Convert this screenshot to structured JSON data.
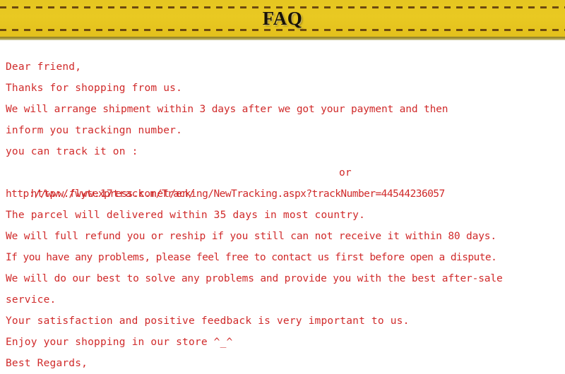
{
  "banner": {
    "title": "FAQ",
    "background_color": "#E6C620",
    "dash_color": "#6D4A10",
    "shadow_color": "#8E7D23"
  },
  "body": {
    "text_color": "#D02A2A",
    "background_color": "#FFFFFF",
    "lines": [
      "Dear friend,",
      "Thanks for shopping from us.",
      "We will arrange shipment within 3 days after we got your payment and then",
      "inform you trackingn number.",
      "you can track it on :",
      "http://www.17track.net/en/",
      "http://www.flytexpress.com/Tracking/NewTracking.aspx?trackNumber=44544236057",
      "The parcel will delivered within 35 days in most country.",
      "We will full refund you or reship if you still can not receive it within 80 days.",
      "If you have any problems, please feel free to contact us first before open a dispute.",
      "We will do our best to solve any problems and provide you with the best after-sale",
      "service.",
      "Your satisfaction and positive feedback is very important to us.",
      "Enjoy your shopping in our store ^_^",
      "Best Regards,"
    ],
    "or_separator": "or",
    "tracking_url_1": "http://www.17track.net/en/",
    "tracking_url_2": "http://www.flytexpress.com/Tracking/NewTracking.aspx?trackNumber=44544236057",
    "tracking_number": "44544236057",
    "shipping_days": "3",
    "delivery_days": "35",
    "refund_days": "80"
  }
}
